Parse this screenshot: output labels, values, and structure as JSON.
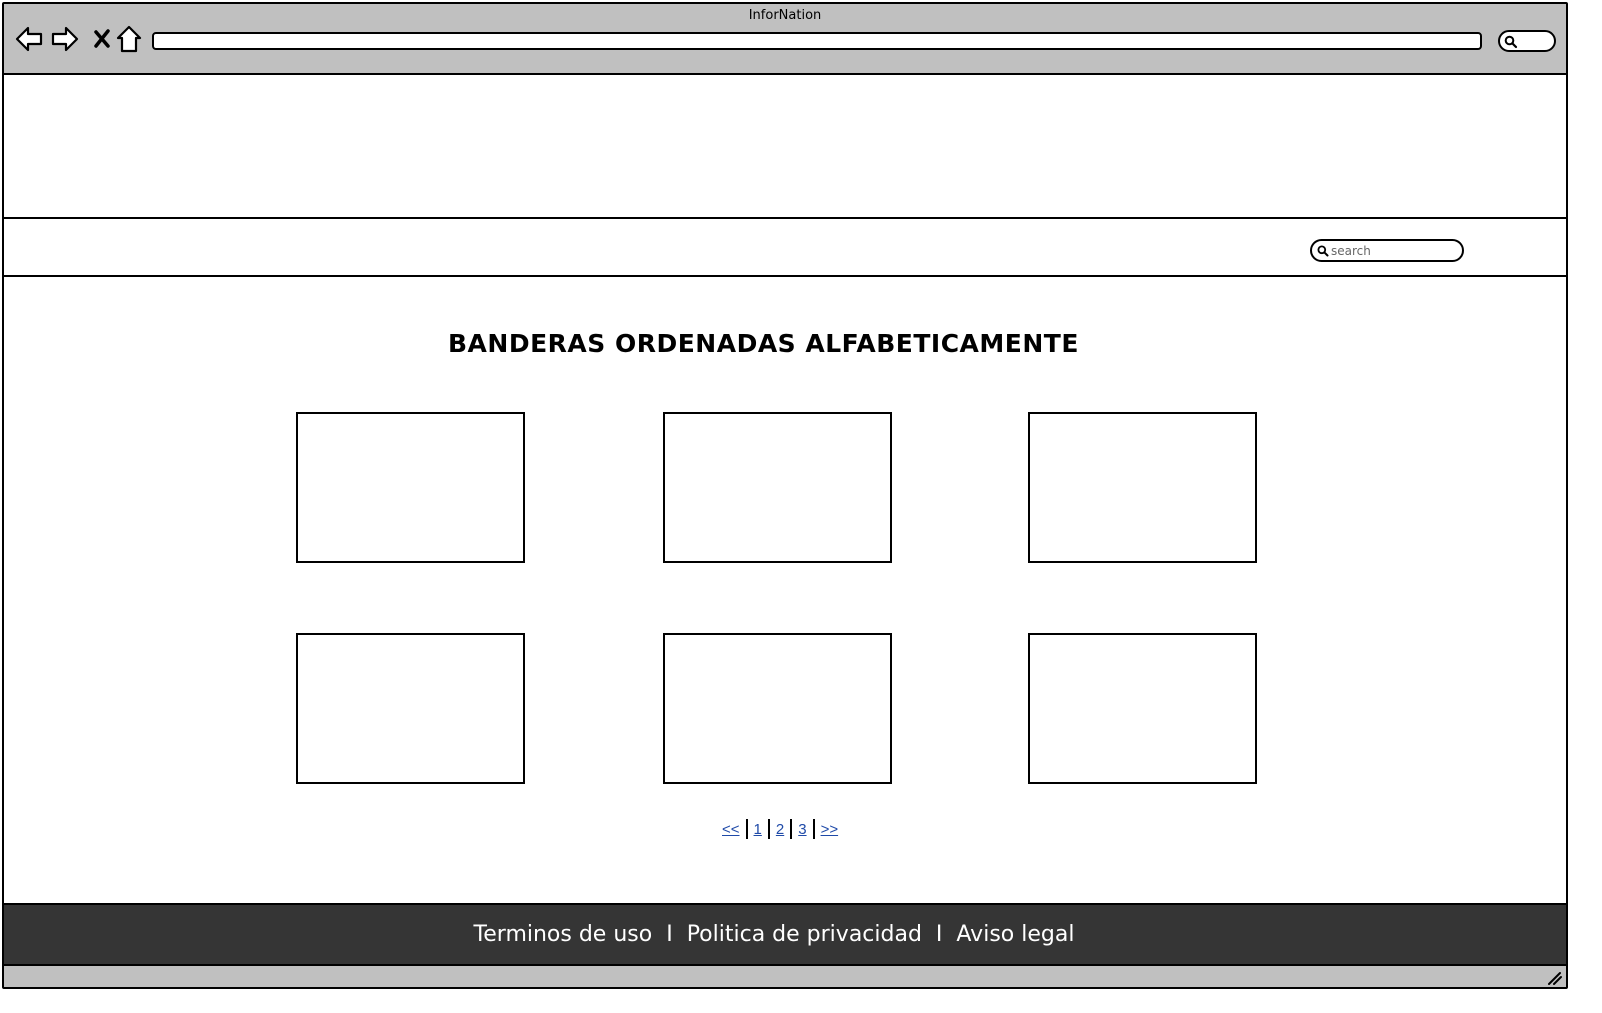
{
  "window": {
    "title": "InforNation"
  },
  "browser": {
    "back_icon": "back-arrow-icon",
    "forward_icon": "forward-arrow-icon",
    "stop_icon": "close-icon",
    "home_icon": "home-icon",
    "url_value": "",
    "search_icon": "search-icon"
  },
  "navbar": {
    "search": {
      "placeholder": "search",
      "value": ""
    }
  },
  "main": {
    "title": "BANDERAS ORDENADAS ALFABETICAMENTE",
    "flags": [
      {
        "label": ""
      },
      {
        "label": ""
      },
      {
        "label": ""
      },
      {
        "label": ""
      },
      {
        "label": ""
      },
      {
        "label": ""
      }
    ],
    "pagination": {
      "first": "<<",
      "pages": [
        "1",
        "2",
        "3"
      ],
      "last": ">>"
    }
  },
  "footer": {
    "links": [
      "Terminos de uso",
      "Politica de privacidad",
      "Aviso legal"
    ],
    "separator": "I"
  },
  "colors": {
    "chrome": "#c0c0c0",
    "footer_bg": "#353535",
    "footer_text": "#ffffff",
    "link": "#1f4aa8"
  }
}
